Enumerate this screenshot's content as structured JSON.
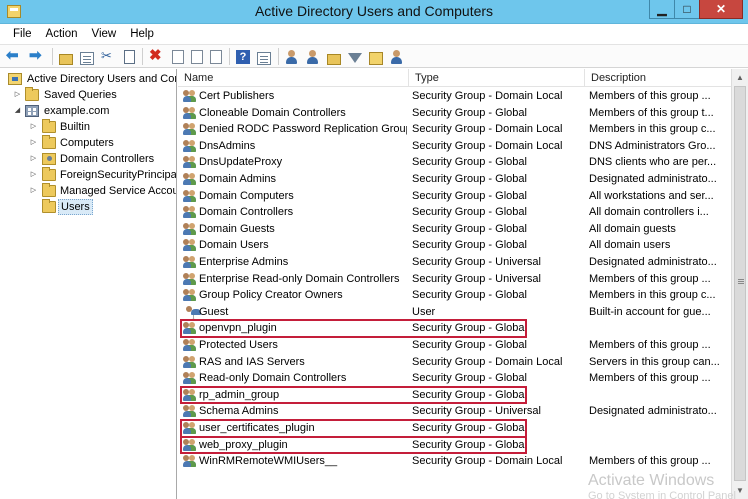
{
  "window": {
    "title": "Active Directory Users and Computers",
    "minimize_glyph": "▁",
    "maximize_glyph": "□",
    "close_glyph": "✕"
  },
  "menu": [
    "File",
    "Action",
    "View",
    "Help"
  ],
  "toolbar": {
    "icons": [
      "back-arrow-icon",
      "forward-arrow-icon",
      "up-folder-icon",
      "show-console-tree-icon",
      "cut-icon",
      "copy-icon",
      "delete-icon",
      "properties-icon",
      "refresh-icon",
      "export-list-icon",
      "help-icon",
      "create-user-icon",
      "create-group-icon",
      "add-to-group-icon",
      "filter-icon",
      "find-icon",
      "new-ou-icon"
    ]
  },
  "tree": {
    "root": "Active Directory Users and Com",
    "saved_queries": "Saved Queries",
    "domain": "example.com",
    "children": [
      "Builtin",
      "Computers",
      "Domain Controllers",
      "ForeignSecurityPrincipals",
      "Managed Service Accour",
      "Users"
    ],
    "selected": "Users"
  },
  "columns": {
    "name": "Name",
    "type": "Type",
    "description": "Description"
  },
  "rows": [
    {
      "name": "Cert Publishers",
      "type": "Security Group - Domain Local",
      "description": "Members of this group ...",
      "icon": "group"
    },
    {
      "name": "Cloneable Domain Controllers",
      "type": "Security Group - Global",
      "description": "Members of this group t...",
      "icon": "group"
    },
    {
      "name": "Denied RODC Password Replication Group",
      "type": "Security Group - Domain Local",
      "description": "Members in this group c...",
      "icon": "group"
    },
    {
      "name": "DnsAdmins",
      "type": "Security Group - Domain Local",
      "description": "DNS Administrators Gro...",
      "icon": "group"
    },
    {
      "name": "DnsUpdateProxy",
      "type": "Security Group - Global",
      "description": "DNS clients who are per...",
      "icon": "group"
    },
    {
      "name": "Domain Admins",
      "type": "Security Group - Global",
      "description": "Designated administrato...",
      "icon": "group"
    },
    {
      "name": "Domain Computers",
      "type": "Security Group - Global",
      "description": "All workstations and ser...",
      "icon": "group"
    },
    {
      "name": "Domain Controllers",
      "type": "Security Group - Global",
      "description": "All domain controllers i...",
      "icon": "group"
    },
    {
      "name": "Domain Guests",
      "type": "Security Group - Global",
      "description": "All domain guests",
      "icon": "group"
    },
    {
      "name": "Domain Users",
      "type": "Security Group - Global",
      "description": "All domain users",
      "icon": "group"
    },
    {
      "name": "Enterprise Admins",
      "type": "Security Group - Universal",
      "description": "Designated administrato...",
      "icon": "group"
    },
    {
      "name": "Enterprise Read-only Domain Controllers",
      "type": "Security Group - Universal",
      "description": "Members of this group ...",
      "icon": "group"
    },
    {
      "name": "Group Policy Creator Owners",
      "type": "Security Group - Global",
      "description": "Members in this group c...",
      "icon": "group"
    },
    {
      "name": "Guest",
      "type": "User",
      "description": "Built-in account for gue...",
      "icon": "user-disabled"
    },
    {
      "name": "openvpn_plugin",
      "type": "Security Group - Global",
      "description": "",
      "icon": "group",
      "highlight": true
    },
    {
      "name": "Protected Users",
      "type": "Security Group - Global",
      "description": "Members of this group ...",
      "icon": "group"
    },
    {
      "name": "RAS and IAS Servers",
      "type": "Security Group - Domain Local",
      "description": "Servers in this group can...",
      "icon": "group"
    },
    {
      "name": "Read-only Domain Controllers",
      "type": "Security Group - Global",
      "description": "Members of this group ...",
      "icon": "group"
    },
    {
      "name": "rp_admin_group",
      "type": "Security Group - Global",
      "description": "",
      "icon": "group",
      "highlight": true
    },
    {
      "name": "Schema Admins",
      "type": "Security Group - Universal",
      "description": "Designated administrato...",
      "icon": "group"
    },
    {
      "name": "user_certificates_plugin",
      "type": "Security Group - Global",
      "description": "",
      "icon": "group",
      "highlight": true
    },
    {
      "name": "web_proxy_plugin",
      "type": "Security Group - Global",
      "description": "",
      "icon": "group",
      "highlight": true
    },
    {
      "name": "WinRMRemoteWMIUsers__",
      "type": "Security Group - Domain Local",
      "description": "Members of this group ...",
      "icon": "group"
    }
  ],
  "watermark": {
    "line1": "Activate Windows",
    "line2": "Go to System in Control Panel"
  },
  "colors": {
    "titlebar": "#6ec6ec",
    "close_button": "#c7473f",
    "highlight_box": "#c41e3a"
  }
}
